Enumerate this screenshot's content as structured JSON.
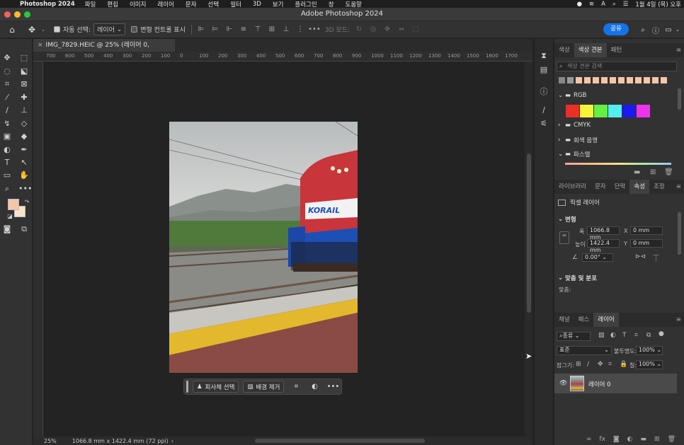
{
  "menubar": {
    "app": "Photoshop 2024",
    "items": [
      "파일",
      "편집",
      "이미지",
      "레이어",
      "문자",
      "선택",
      "필터",
      "3D",
      "보기",
      "플러그인",
      "창",
      "도움말"
    ],
    "clock": "1월 4일 (목) 오후"
  },
  "window": {
    "title": "Adobe Photoshop 2024"
  },
  "options": {
    "auto_select_label": "자동 선택:",
    "auto_select_value": "레이어",
    "transform_label": "변형 컨트롤 표시",
    "mode3d_label": "3D 모드:",
    "share_label": "공유"
  },
  "document": {
    "tab_title": "IMG_7829.HEIC @ 25% (레이어 0, RGB/8*) *",
    "ruler_marks": [
      "700",
      "600",
      "500",
      "400",
      "300",
      "200",
      "100",
      "0",
      "100",
      "200",
      "300",
      "400",
      "500",
      "600",
      "700",
      "800",
      "900",
      "1000",
      "1100",
      "1200",
      "1300",
      "1400",
      "1500",
      "1600",
      "1700"
    ],
    "photo_text": "KORAIL"
  },
  "context_bar": {
    "subject_select": "피사체 선택",
    "remove_bg": "배경 제거"
  },
  "status": {
    "zoom": "25%",
    "info": "1066.8 mm x 1422.4 mm (72 ppi)"
  },
  "swatches_panel": {
    "tabs": [
      "색상",
      "색상 견본",
      "패턴"
    ],
    "active_tab": 1,
    "search_placeholder": "색상 견본 검색",
    "groups": [
      "RGB",
      "CMYK",
      "회색 음영",
      "파스텔"
    ],
    "recent_colors": [
      "#888888",
      "#999999",
      "#f5c6a8",
      "#f5c6a8",
      "#f5c6a8",
      "#f5c6a8",
      "#f5c6a8",
      "#f5c6a8",
      "#f5c6a8",
      "#f5c6a8",
      "#f5c6a8",
      "#f5c6a8",
      "#f5c6a8"
    ],
    "rgb_colors": [
      "#e8302a",
      "#f7f33a",
      "#66ee44",
      "#55eeee",
      "#1a1aee",
      "#ee33ee"
    ]
  },
  "properties_panel": {
    "tabs": [
      "라이브러리",
      "문자",
      "단락",
      "속성",
      "조정"
    ],
    "active_tab": 3,
    "layer_type": "픽셀 레이어",
    "transform_section": "변형",
    "width_label": "폭",
    "width_value": "1066.8 mm",
    "height_label": "높이",
    "height_value": "1422.4 mm",
    "x_label": "X",
    "x_value": "0 mm",
    "y_label": "Y",
    "y_value": "0 mm",
    "angle_value": "0.00°",
    "align_section": "맞춤 및 분포",
    "align_label": "맞춤:"
  },
  "layers_panel": {
    "tabs": [
      "채널",
      "패스",
      "레이어"
    ],
    "active_tab": 2,
    "filter_label": "종류",
    "blend_mode": "표준",
    "opacity_label": "불투명도:",
    "opacity_value": "100%",
    "lock_label": "잠그기:",
    "fill_label": "칠:",
    "fill_value": "100%",
    "layer_name": "레이어 0"
  }
}
